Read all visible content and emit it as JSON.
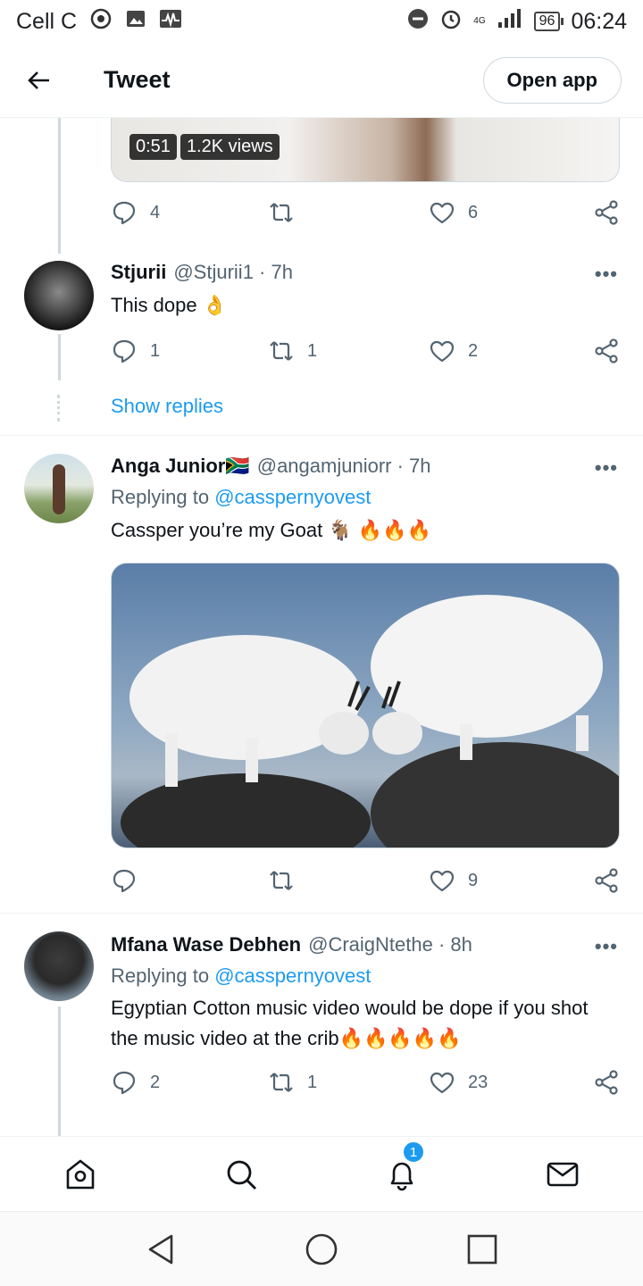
{
  "status_bar": {
    "carrier": "Cell C",
    "network": "4G",
    "battery": "96",
    "time": "06:24"
  },
  "header": {
    "title": "Tweet",
    "open_app": "Open app"
  },
  "top_tweet": {
    "video_time": "0:51",
    "video_views": "1.2K views",
    "reply_count": "4",
    "retweet_count": "",
    "like_count": "6"
  },
  "tweets": [
    {
      "name": "Stjurii",
      "handle": "@Stjurii1 · 7h",
      "reply_prefix": "",
      "mention": "",
      "text": "This dope 👌",
      "reply_count": "1",
      "retweet_count": "1",
      "like_count": "2",
      "show_replies": "Show replies"
    },
    {
      "name": "Anga Junior🇿🇦",
      "handle": "@angamjuniorr · 7h",
      "reply_prefix": "Replying to",
      "mention": "@casspernyovest",
      "text": "Cassper you’re my Goat 🐐 🔥🔥🔥",
      "reply_count": "",
      "retweet_count": "",
      "like_count": "9"
    },
    {
      "name": "Mfana Wase Debhen",
      "handle": "@CraigNtethe · 8h",
      "reply_prefix": "Replying to",
      "mention": "@casspernyovest",
      "text": "Egyptian Cotton music video would be dope if you shot the music video at the crib🔥🔥🔥🔥🔥",
      "reply_count": "2",
      "retweet_count": "1",
      "like_count": "23"
    }
  ],
  "bottom_nav": {
    "items": [
      "home-icon",
      "search-icon",
      "notifications-icon",
      "messages-icon"
    ],
    "notification_badge": "1"
  },
  "colors": {
    "accent": "#1d9bf0",
    "text": "#0f1419",
    "secondary": "#536471",
    "border": "#cfd9de"
  }
}
